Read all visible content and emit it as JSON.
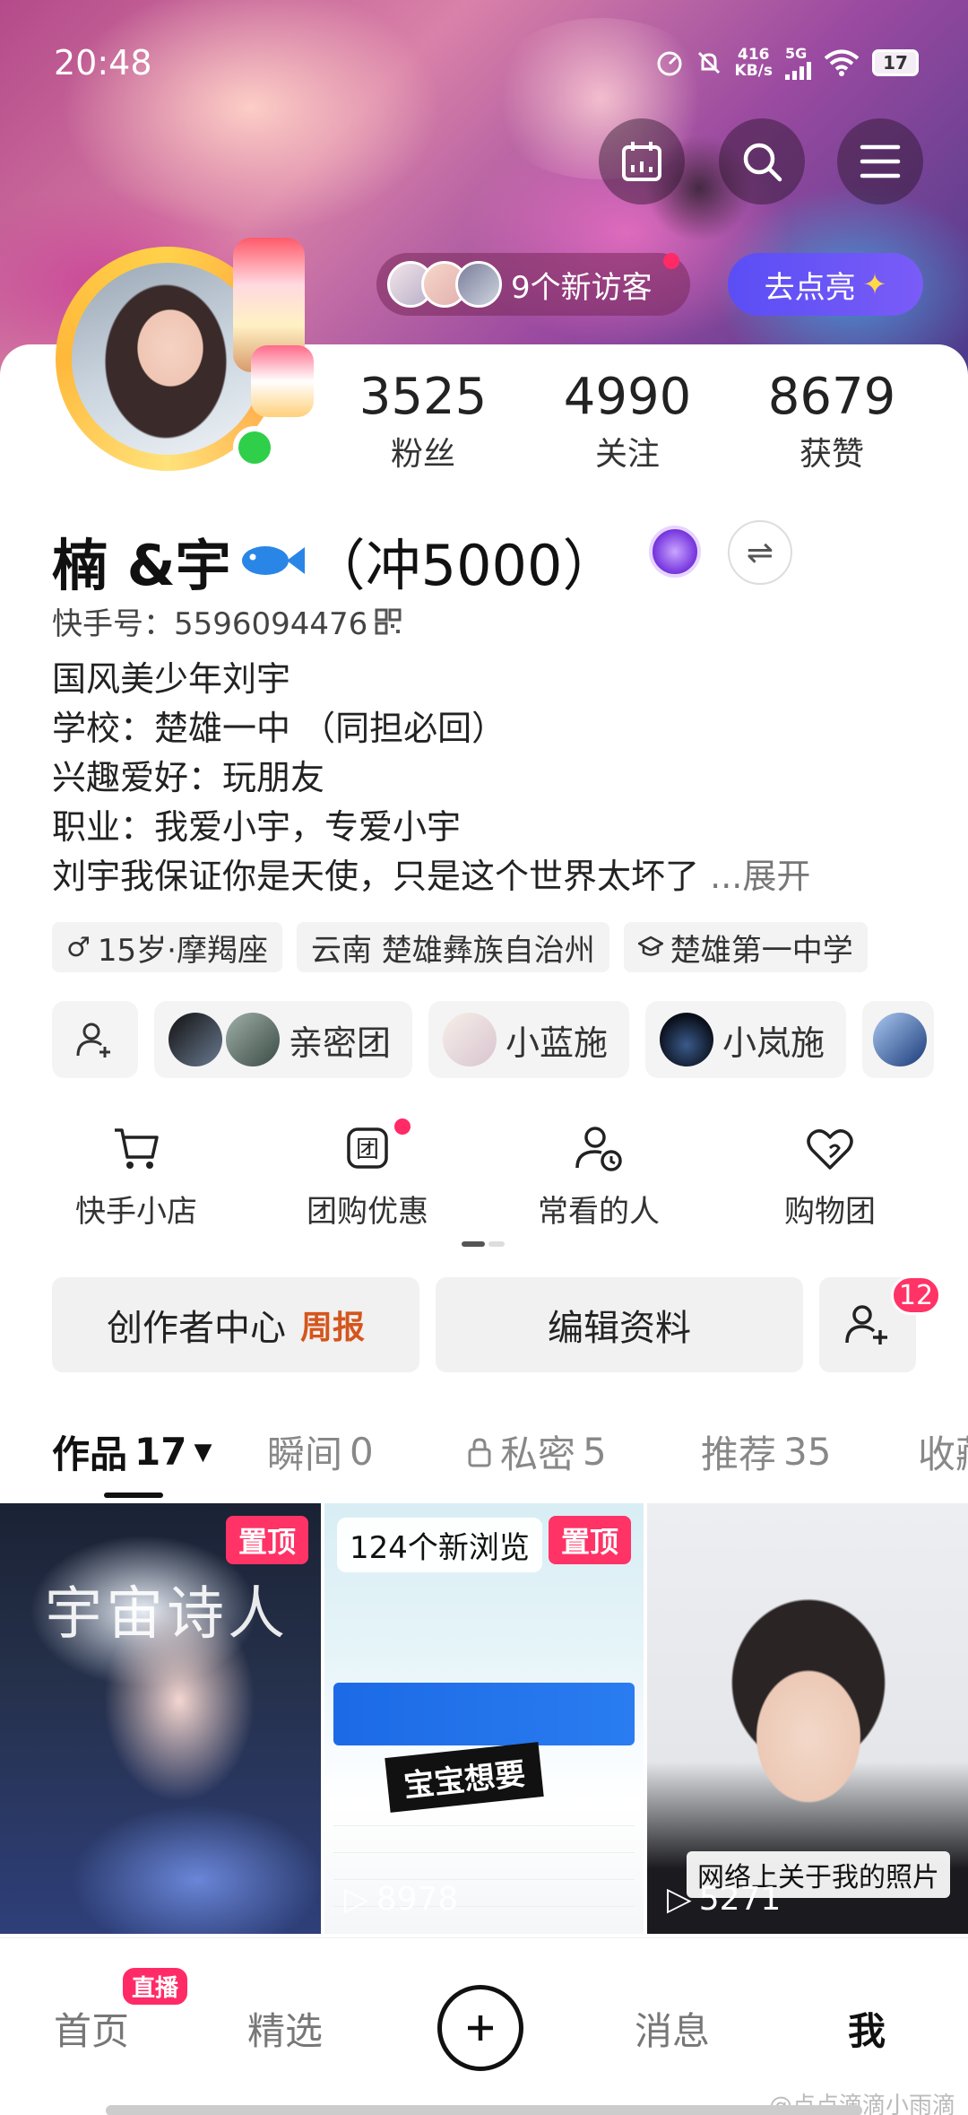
{
  "status_bar": {
    "time": "20:48",
    "speed_value": "416",
    "speed_unit": "KB/s",
    "network": "5G",
    "battery": "17"
  },
  "profile": {
    "visitors_text": "9个新访客",
    "light_button": "去点亮",
    "stats": [
      {
        "value": "3525",
        "label": "粉丝"
      },
      {
        "value": "4990",
        "label": "关注"
      },
      {
        "value": "8679",
        "label": "获赞"
      }
    ],
    "name": "楠 &宇",
    "name_suffix": "（冲5000）",
    "kuaishou_id": "快手号：5596094476",
    "bio": [
      "国风美少年刘宇",
      "学校：楚雄一中 （同担必回）",
      "兴趣爱好：玩朋友",
      "职业：我爱小宇，专爱小宇",
      "刘宇我保证你是天使，只是这个世界太坏了"
    ],
    "bio_more": "...展开",
    "tags": [
      {
        "icon": "male-icon",
        "text": "15岁·摩羯座"
      },
      {
        "icon": "",
        "text": "云南 楚雄彝族自治州"
      },
      {
        "icon": "school-icon",
        "text": "楚雄第一中学"
      }
    ],
    "groups": [
      {
        "name": "亲密团"
      },
      {
        "name": "小蓝施"
      },
      {
        "name": "小岚施"
      }
    ]
  },
  "shortcuts": [
    {
      "icon": "cart-icon",
      "label": "快手小店"
    },
    {
      "icon": "group-buy-icon",
      "label": "团购优惠"
    },
    {
      "icon": "frequent-person-icon",
      "label": "常看的人"
    },
    {
      "icon": "heart-bag-icon",
      "label": "购物团"
    }
  ],
  "actions": {
    "creator_center": "创作者中心",
    "weekly": "周报",
    "edit_profile": "编辑资料",
    "friend_badge": "12"
  },
  "tabs": [
    {
      "label": "作品",
      "count": "17"
    },
    {
      "label": "瞬间",
      "count": "0"
    },
    {
      "label": "私密",
      "count": "5"
    },
    {
      "label": "推荐",
      "count": "35"
    },
    {
      "label": "收藏",
      "count": ""
    }
  ],
  "works": [
    {
      "title_text": "宇宙诗人",
      "pinned": "置顶",
      "plays": ""
    },
    {
      "new_browse": "124个新浏览",
      "pinned": "置顶",
      "overlay": "宝宝想要",
      "plays": "8978"
    },
    {
      "caption": "网络上关于我的照片",
      "plays": "5271"
    }
  ],
  "bottom_nav": {
    "home": "首页",
    "live": "直播",
    "featured": "精选",
    "messages": "消息",
    "me": "我"
  },
  "watermark": "@点点滴滴小雨滴",
  "colors": {
    "accent_red": "#ff2a66",
    "light_btn": "#5a4ef5",
    "weekly_orange": "#d5551c",
    "online_green": "#2fcf4a"
  }
}
